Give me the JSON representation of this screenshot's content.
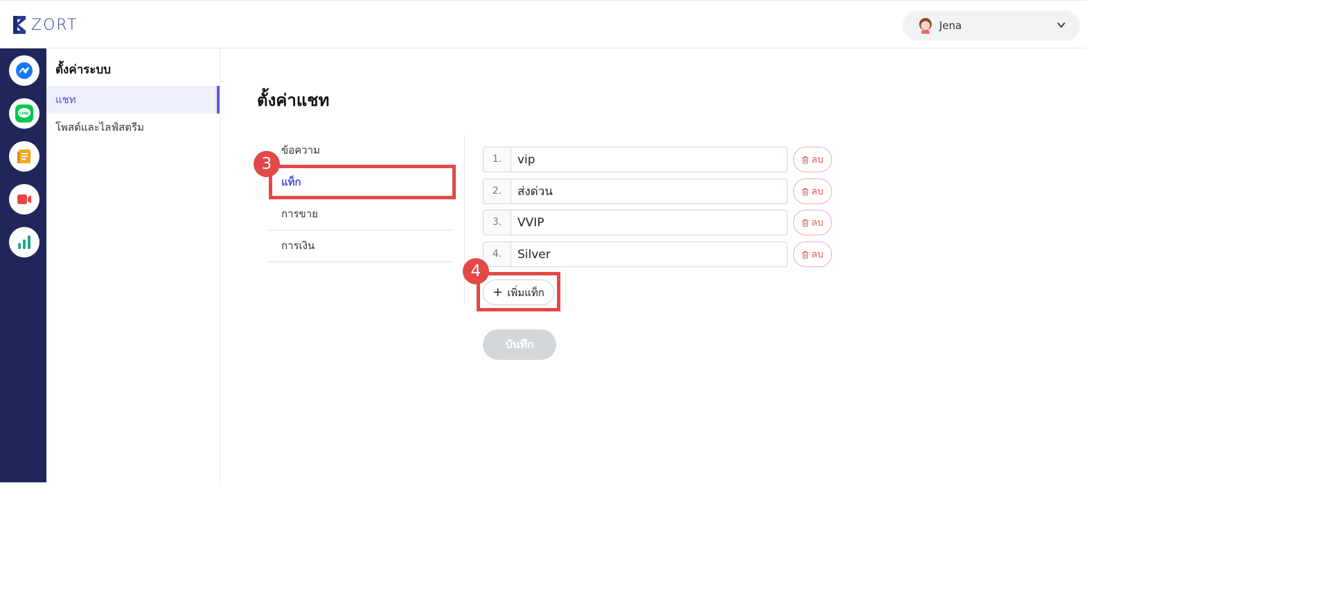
{
  "app": {
    "logo_text": "ZORT",
    "brand_color": "#2b3a8f"
  },
  "user": {
    "name": "Jena"
  },
  "rail": {
    "items": [
      {
        "icon": "messenger-icon",
        "color": "#1877f2"
      },
      {
        "icon": "line-icon",
        "color": "#06c755"
      },
      {
        "icon": "orders-icon",
        "color": "#f5a623"
      },
      {
        "icon": "live-video-icon",
        "color": "#ef4444"
      },
      {
        "icon": "report-chart-icon",
        "color": "#22a68a"
      }
    ]
  },
  "sidebar": {
    "title": "ตั้งค่าระบบ",
    "items": [
      {
        "label": "แชท",
        "active": true
      },
      {
        "label": "โพสต์และไลฟ์สตรีม",
        "active": false
      }
    ]
  },
  "main": {
    "title": "ตั้งค่าแชท",
    "tabs": [
      {
        "label": "ข้อความ",
        "active": false
      },
      {
        "label": "แท็ก",
        "active": true
      },
      {
        "label": "การขาย",
        "active": false
      },
      {
        "label": "การเงิน",
        "active": false
      }
    ],
    "tags": [
      {
        "num": "1.",
        "value": "vip"
      },
      {
        "num": "2.",
        "value": "ส่งด่วน"
      },
      {
        "num": "3.",
        "value": "VVIP"
      },
      {
        "num": "4.",
        "value": "Silver"
      }
    ],
    "delete_label": "ลบ",
    "add_label": "เพิ่มแท็ก",
    "add_symbol": "+",
    "save_label": "บันทึก"
  },
  "annotations": {
    "step_tag_tab": "3",
    "step_add_tag": "4",
    "color": "#e34848"
  }
}
